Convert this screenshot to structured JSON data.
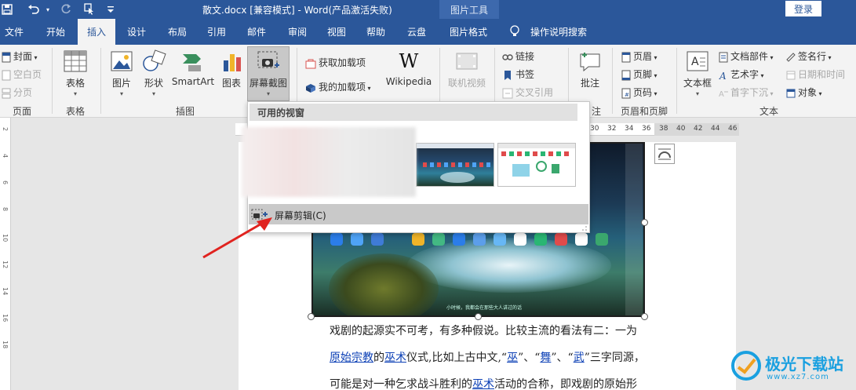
{
  "titlebar": {
    "save_icon": "save-icon",
    "undo_icon": "undo-icon",
    "redo_icon": "redo-icon",
    "touch_icon": "touch-mode-icon",
    "customize_icon": "customize-icon",
    "title": "散文.docx [兼容模式] - Word(产品激活失败)",
    "context_tab_group": "图片工具",
    "login": "登录"
  },
  "tabs": [
    "文件",
    "开始",
    "插入",
    "设计",
    "布局",
    "引用",
    "邮件",
    "审阅",
    "视图",
    "帮助",
    "云盘",
    "图片格式"
  ],
  "active_tab": "插入",
  "tell_me": "操作说明搜索",
  "ribbon": {
    "pages": {
      "cover": "封面",
      "blank": "空白页",
      "break": "分页",
      "group": "页面"
    },
    "tables": {
      "table": "表格",
      "group": "表格"
    },
    "illustrations": {
      "picture": "图片",
      "shape": "形状",
      "smartart": "SmartArt",
      "chart": "图表",
      "screenshot": "屏幕截图",
      "group": "插图"
    },
    "addins": {
      "get": "获取加载项",
      "my": "我的加载项",
      "wikipedia": "Wikipedia"
    },
    "media": {
      "online_video": "联机视频"
    },
    "links": {
      "link": "链接",
      "bookmark": "书签",
      "cross_ref": "交叉引用"
    },
    "comments": {
      "comment": "批注",
      "group_partial": "注"
    },
    "header_footer": {
      "header": "页眉",
      "footer": "页脚",
      "page_number": "页码",
      "group": "页眉和页脚"
    },
    "text": {
      "textbox": "文本框",
      "quick_parts": "文档部件",
      "wordart": "艺术字",
      "dropcap": "首字下沉",
      "signature": "签名行",
      "datetime": "日期和时间",
      "object": "对象",
      "group": "文本"
    }
  },
  "screenshot_menu": {
    "header": "可用的视窗",
    "screen_clipping": "屏幕剪辑(C)"
  },
  "ruler_ticks": [
    "30",
    "32",
    "34",
    "36",
    "38",
    "40",
    "42",
    "44",
    "46"
  ],
  "vruler_ticks": [
    "2",
    "4",
    "6",
    "8",
    "10",
    "12",
    "14",
    "16",
    "18"
  ],
  "picture_caption": "小时候，我都会在那些大人讲过的话",
  "document": {
    "line1": "戏剧的起源实不可考，有多种假说。比较主流的看法有二：一为",
    "line2": [
      {
        "t": "原始宗教",
        "link": true
      },
      {
        "t": "的",
        "link": false
      },
      {
        "t": "巫术",
        "link": true
      },
      {
        "t": "仪式,比如上古中文,“",
        "link": false
      },
      {
        "t": "巫",
        "link": true
      },
      {
        "t": "”、“",
        "link": false
      },
      {
        "t": "舞",
        "link": true
      },
      {
        "t": "”、“",
        "link": false
      },
      {
        "t": "武",
        "link": true
      },
      {
        "t": "”三字同源，",
        "link": false
      }
    ],
    "line3": [
      {
        "t": "可能是对一种乞求战斗胜利的",
        "link": false
      },
      {
        "t": "巫术",
        "link": true
      },
      {
        "t": "活动的合称，即戏剧的原始形",
        "link": false
      }
    ]
  },
  "watermark": {
    "name": "极光下载站",
    "url": "www.xz7.com"
  },
  "colors": {
    "word_blue": "#2b579a",
    "link_blue": "#0b3fb5",
    "arrow_red": "#e0231f"
  }
}
